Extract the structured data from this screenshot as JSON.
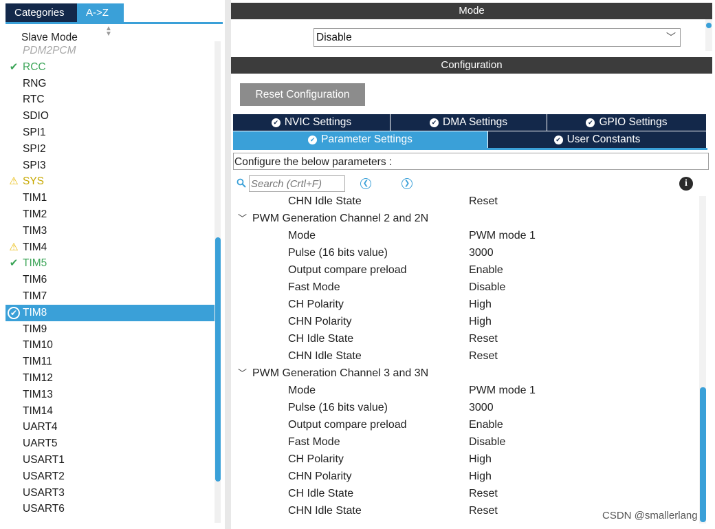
{
  "left_panel": {
    "tabs": [
      {
        "label": "Categories"
      },
      {
        "label": "A->Z"
      }
    ],
    "items": [
      {
        "label": "PDM2PCM",
        "state": "disabled"
      },
      {
        "label": "RCC",
        "state": "ok"
      },
      {
        "label": "RNG",
        "state": "none"
      },
      {
        "label": "RTC",
        "state": "none"
      },
      {
        "label": "SDIO",
        "state": "none"
      },
      {
        "label": "SPI1",
        "state": "none"
      },
      {
        "label": "SPI2",
        "state": "none"
      },
      {
        "label": "SPI3",
        "state": "none"
      },
      {
        "label": "SYS",
        "state": "warn"
      },
      {
        "label": "TIM1",
        "state": "none"
      },
      {
        "label": "TIM2",
        "state": "none"
      },
      {
        "label": "TIM3",
        "state": "none"
      },
      {
        "label": "TIM4",
        "state": "plain-warn"
      },
      {
        "label": "TIM5",
        "state": "ok"
      },
      {
        "label": "TIM6",
        "state": "none"
      },
      {
        "label": "TIM7",
        "state": "none"
      },
      {
        "label": "TIM8",
        "state": "selected"
      },
      {
        "label": "TIM9",
        "state": "none"
      },
      {
        "label": "TIM10",
        "state": "none"
      },
      {
        "label": "TIM11",
        "state": "none"
      },
      {
        "label": "TIM12",
        "state": "none"
      },
      {
        "label": "TIM13",
        "state": "none"
      },
      {
        "label": "TIM14",
        "state": "none"
      },
      {
        "label": "UART4",
        "state": "none"
      },
      {
        "label": "UART5",
        "state": "none"
      },
      {
        "label": "USART1",
        "state": "none"
      },
      {
        "label": "USART2",
        "state": "none"
      },
      {
        "label": "USART3",
        "state": "none"
      },
      {
        "label": "USART6",
        "state": "none"
      }
    ]
  },
  "mode": {
    "title": "Mode",
    "slave_mode_label": "Slave Mode",
    "slave_mode_value": "Disable"
  },
  "configuration": {
    "title": "Configuration",
    "reset_label": "Reset Configuration",
    "tabs_row1": [
      {
        "label": "NVIC Settings",
        "width": 229
      },
      {
        "label": "DMA Settings",
        "width": 228
      },
      {
        "label": "GPIO Settings",
        "width": 232
      }
    ],
    "tabs_row2": [
      {
        "label": "Parameter Settings",
        "active": true,
        "width": 371
      },
      {
        "label": "User Constants",
        "active": false,
        "width": 318
      }
    ],
    "configure_text": "Configure the below parameters :",
    "search_placeholder": "Search (Crtl+F)",
    "rows": [
      {
        "type": "param",
        "name": "CHN Idle State",
        "value": "Reset"
      },
      {
        "type": "group",
        "name": "PWM Generation Channel 2 and 2N"
      },
      {
        "type": "param",
        "name": "Mode",
        "value": "PWM mode 1"
      },
      {
        "type": "param",
        "name": "Pulse (16 bits value)",
        "value": "3000"
      },
      {
        "type": "param",
        "name": "Output compare preload",
        "value": "Enable"
      },
      {
        "type": "param",
        "name": "Fast Mode",
        "value": "Disable"
      },
      {
        "type": "param",
        "name": "CH Polarity",
        "value": "High"
      },
      {
        "type": "param",
        "name": "CHN Polarity",
        "value": "High"
      },
      {
        "type": "param",
        "name": "CH Idle State",
        "value": "Reset"
      },
      {
        "type": "param",
        "name": "CHN Idle State",
        "value": "Reset"
      },
      {
        "type": "group",
        "name": "PWM Generation Channel 3 and 3N"
      },
      {
        "type": "param",
        "name": "Mode",
        "value": "PWM mode 1"
      },
      {
        "type": "param",
        "name": "Pulse (16 bits value)",
        "value": "3000"
      },
      {
        "type": "param",
        "name": "Output compare preload",
        "value": "Enable"
      },
      {
        "type": "param",
        "name": "Fast Mode",
        "value": "Disable"
      },
      {
        "type": "param",
        "name": "CH Polarity",
        "value": "High"
      },
      {
        "type": "param",
        "name": "CHN Polarity",
        "value": "High"
      },
      {
        "type": "param",
        "name": "CH Idle State",
        "value": "Reset"
      },
      {
        "type": "param",
        "name": "CHN Idle State",
        "value": "Reset"
      }
    ]
  },
  "watermark": "CSDN @smallerlang",
  "colors": {
    "accent": "#3aa0d8",
    "navy": "#13284a",
    "ok": "#3ca558",
    "warn": "#e8b800"
  }
}
